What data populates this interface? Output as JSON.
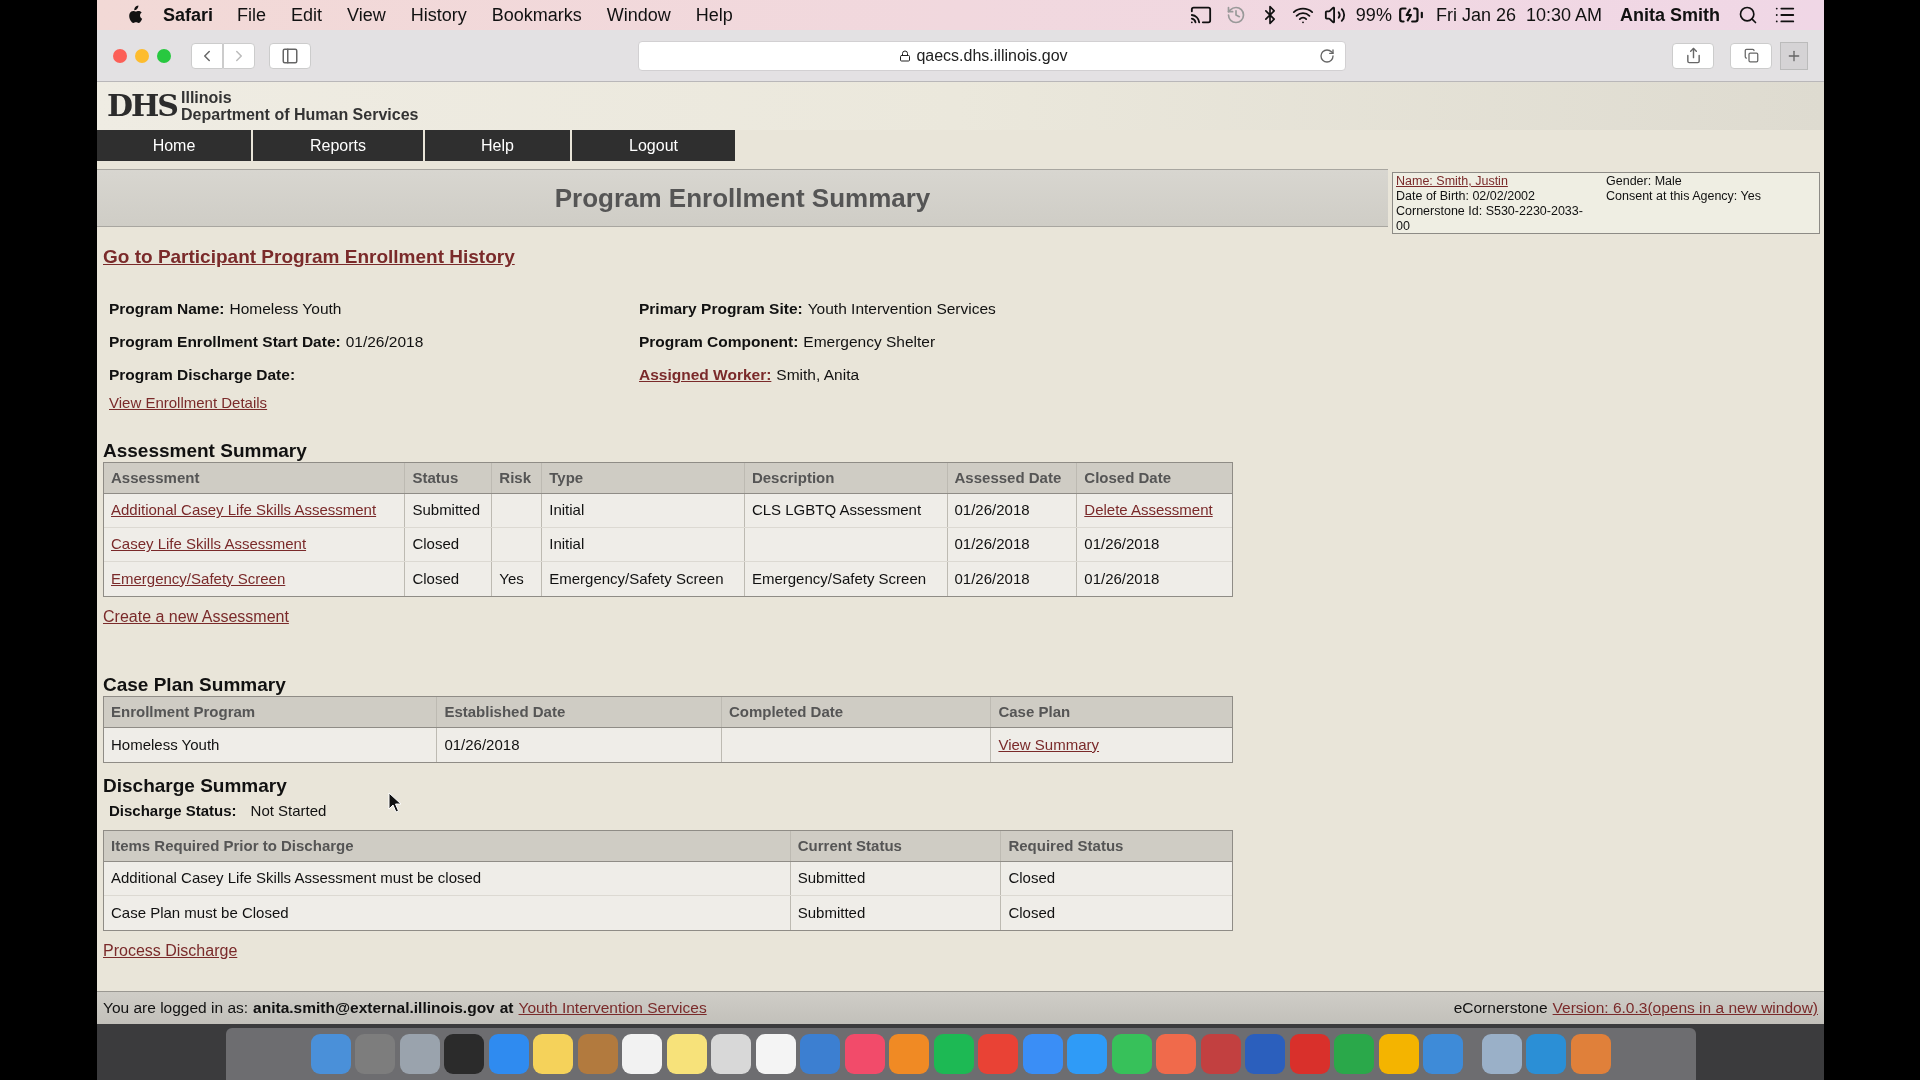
{
  "menu_bar": {
    "app": "Safari",
    "menus": [
      "File",
      "Edit",
      "View",
      "History",
      "Bookmarks",
      "Window",
      "Help"
    ],
    "battery": "99%",
    "clock": "Fri Jan 26  10:30 AM",
    "user": "Anita Smith"
  },
  "browser": {
    "url": "qaecs.dhs.illinois.gov"
  },
  "header": {
    "logo": "DHS",
    "org_line_1": "Illinois",
    "org_line_2": "Department of Human Services"
  },
  "nav": [
    "Home",
    "Reports",
    "Help",
    "Logout"
  ],
  "title": "Program Enrollment Summary",
  "participant": {
    "name": "Name: Smith, Justin",
    "dob": "Date of Birth: 02/02/2002",
    "cornerstone_id": "Cornerstone Id: S530-2230-2033-00",
    "gender": "Gender: Male",
    "consent": "Consent at this Agency: Yes"
  },
  "history_link": "Go to Participant Program Enrollment History",
  "program_fields": [
    {
      "label": "Program Name:",
      "value": "Homeless Youth",
      "link": false
    },
    {
      "label": "Primary Program Site:",
      "value": "Youth Intervention Services",
      "link": false
    },
    {
      "label": "Program Enrollment Start Date:",
      "value": "01/26/2018",
      "link": false
    },
    {
      "label": "Program Component:",
      "value": "Emergency Shelter",
      "link": false
    },
    {
      "label": "Program Discharge Date:",
      "link": false
    },
    {
      "label": "Assigned Worker:",
      "value": "Smith, Anita",
      "link": true
    }
  ],
  "details_link": "View Enrollment Details",
  "assessment": {
    "heading": "Assessment Summary",
    "columns": [
      "Assessment",
      "Status",
      "Risk",
      "Type",
      "Description",
      "Assessed Date",
      "Closed Date"
    ],
    "rows": [
      [
        {
          "text": "Additional Casey Life Skills Assessment",
          "link": true
        },
        {
          "text": "Submitted",
          "link": false
        },
        null,
        {
          "text": "Initial",
          "link": false
        },
        {
          "text": "CLS LGBTQ Assessment",
          "link": false
        },
        {
          "text": "01/26/2018",
          "link": false
        },
        {
          "text": "Delete Assessment",
          "link": true
        }
      ],
      [
        {
          "text": "Casey Life Skills Assessment",
          "link": true
        },
        {
          "text": "Closed",
          "link": false
        },
        null,
        {
          "text": "Initial",
          "link": false
        },
        null,
        {
          "text": "01/26/2018",
          "link": false
        },
        {
          "text": "01/26/2018",
          "link": false
        }
      ],
      [
        {
          "text": "Emergency/Safety Screen",
          "link": true
        },
        {
          "text": "Closed",
          "link": false
        },
        {
          "text": "Yes",
          "link": false
        },
        {
          "text": "Emergency/Safety Screen",
          "link": false
        },
        {
          "text": "Emergency/Safety Screen",
          "link": false
        },
        {
          "text": "01/26/2018",
          "link": false
        },
        {
          "text": "01/26/2018",
          "link": false
        }
      ]
    ],
    "create_link": "Create a new Assessment"
  },
  "case_plan": {
    "heading": "Case Plan Summary",
    "columns": [
      "Enrollment Program",
      "Established Date",
      "Completed Date",
      "Case Plan"
    ],
    "rows": [
      [
        {
          "text": "Homeless Youth",
          "link": false
        },
        {
          "text": "01/26/2018",
          "link": false
        },
        null,
        {
          "text": "View Summary",
          "link": true
        }
      ]
    ]
  },
  "discharge": {
    "heading": "Discharge Summary",
    "status_label": "Discharge Status:",
    "status_value": "Not Started",
    "columns": [
      "Items Required Prior to Discharge",
      "Current Status",
      "Required Status"
    ],
    "rows": [
      [
        {
          "text": "Additional Casey Life Skills Assessment must be closed",
          "link": false
        },
        {
          "text": "Submitted",
          "link": false
        },
        {
          "text": "Closed",
          "link": false
        }
      ],
      [
        {
          "text": "Case Plan must be Closed",
          "link": false
        },
        {
          "text": "Submitted",
          "link": false
        },
        {
          "text": "Closed",
          "link": false
        }
      ]
    ],
    "process_link": "Process Discharge"
  },
  "footer": {
    "prefix": "You are logged in as:",
    "email": "anita.smith@external.illinois.gov",
    "at": "at",
    "site_link": "Youth Intervention Services",
    "product": "eCornerstone",
    "version_link": "Version: 6.0.3(opens in a new window)"
  }
}
